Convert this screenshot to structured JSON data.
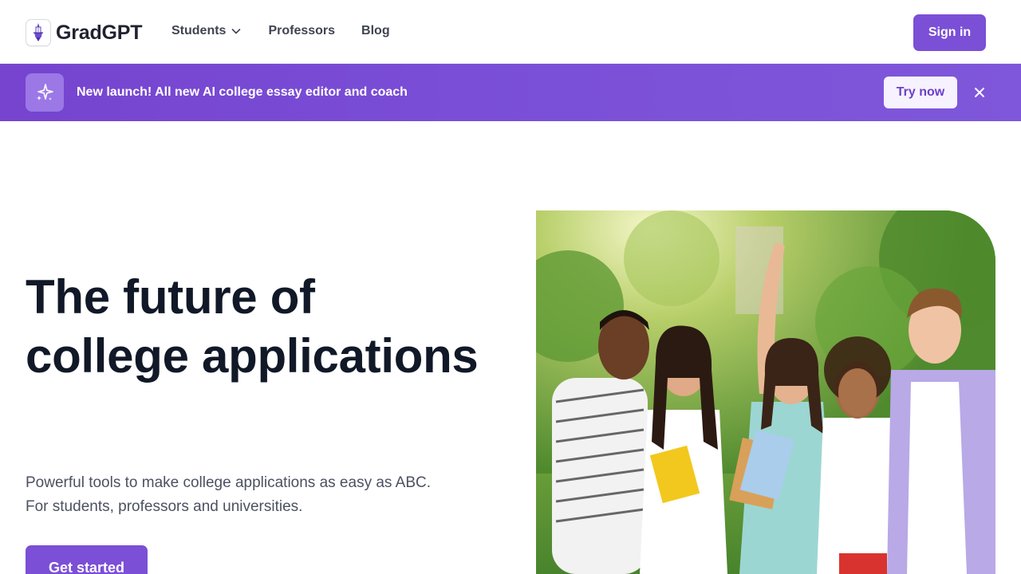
{
  "header": {
    "logo_text": "GradGPT",
    "logo_icon": "university-tower-icon",
    "nav": [
      {
        "label": "Students",
        "has_dropdown": true
      },
      {
        "label": "Professors",
        "has_dropdown": false
      },
      {
        "label": "Blog",
        "has_dropdown": false
      }
    ],
    "signin_label": "Sign in"
  },
  "banner": {
    "icon": "sparkles-icon",
    "text": "New launch! All new AI college essay editor and coach",
    "cta_label": "Try now",
    "close_icon": "close-icon"
  },
  "hero": {
    "title_line1": "The future of",
    "title_line2": "college applications",
    "subtitle_line1": "Powerful tools to make college applications as easy as ABC.",
    "subtitle_line2": "For students, professors and universities.",
    "cta_label": "Get started"
  },
  "colors": {
    "accent": "#7b4fd6",
    "banner": "#7644cf",
    "heading": "#111827",
    "body_text": "#4b5160"
  }
}
